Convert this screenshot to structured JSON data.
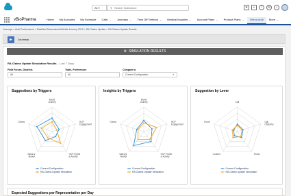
{
  "header": {
    "search_scope": "All",
    "search_placeholder": "Search Salesforce",
    "icons": [
      "star-icon",
      "plus-icon",
      "help-icon",
      "gear-icon",
      "bell-icon"
    ]
  },
  "nav": {
    "app_name": "vBioPharma",
    "items": [
      {
        "label": "Home",
        "chevron": false,
        "active": false
      },
      {
        "label": "My Accounts",
        "chevron": false,
        "active": false
      },
      {
        "label": "My Schedule",
        "chevron": false,
        "active": false
      },
      {
        "label": "Calls",
        "chevron": true,
        "active": false
      },
      {
        "label": "Journeys",
        "chevron": true,
        "active": false
      },
      {
        "label": "Time Off Territory",
        "chevron": true,
        "active": false
      },
      {
        "label": "Medical Inquiries",
        "chevron": true,
        "active": false
      },
      {
        "label": "Account Plans",
        "chevron": true,
        "active": false
      },
      {
        "label": "Product Plans",
        "chevron": true,
        "active": false
      },
      {
        "label": "Veeva Andi",
        "chevron": false,
        "active": true
      },
      {
        "label": "More",
        "chevron": true,
        "active": false
      }
    ]
  },
  "breadcrumb": "Journeys > Andi Performance > Rasbiter Rheumatoid Arthritis Journey 2019 > RA Claims Update > RA Claims Update Results",
  "journeys_bar": {
    "label": "Journeys"
  },
  "simulation": {
    "header": "SIMULATION RESULTS",
    "title": "RA Claims Update Simulation Results",
    "period": "- Last 7 Days",
    "filters": [
      {
        "label": "Field Forces, Districts",
        "value": "All"
      },
      {
        "label": "Traits, Preferences",
        "value": "All"
      },
      {
        "label": "Compare to",
        "value": "Current Configuration"
      }
    ]
  },
  "charts": [
    {
      "title": "Suggestions by Triggers",
      "axes": [
        "Brand Journey",
        "HCP Engagement",
        "HCP Profile & Activity",
        "Sales & Market",
        "Claims"
      ],
      "series": [
        {
          "name": "Current Configuration",
          "color": "#2e8fd6",
          "values": [
            0.55,
            0.3,
            0.25,
            0.45,
            0.65
          ]
        },
        {
          "name": "RA Claims Update Simulation",
          "color": "#f2a324",
          "values": [
            0.4,
            0.2,
            0.6,
            0.3,
            0.45
          ]
        }
      ]
    },
    {
      "title": "Insights by Triggers",
      "axes": [
        "Brand Journey",
        "HCP Engagement",
        "HCP Profile & Activity",
        "Sales & Market",
        "Claims"
      ],
      "series": [
        {
          "name": "Current Configuration",
          "color": "#2e8fd6",
          "values": [
            0.45,
            0.35,
            0.5,
            0.7,
            0.3
          ]
        },
        {
          "name": "RA Claims Update Simulation",
          "color": "#f2a324",
          "values": [
            0.35,
            0.55,
            0.4,
            0.4,
            0.25
          ]
        }
      ]
    },
    {
      "title": "Suggestion by Lever",
      "axes": [
        "Call",
        "Call Objective",
        "Email",
        "Content",
        "Event"
      ],
      "series": [
        {
          "name": "Current Configuration",
          "color": "#2e8fd6",
          "values": [
            0.3,
            0.25,
            0.3,
            0.2,
            0.15
          ]
        },
        {
          "name": "RA Claims Update Simulation",
          "color": "#f2a324",
          "values": [
            0.25,
            0.2,
            0.25,
            0.3,
            0.2
          ]
        }
      ]
    }
  ],
  "bottom": {
    "title": "Expected Suggestions per Representative per Day"
  }
}
